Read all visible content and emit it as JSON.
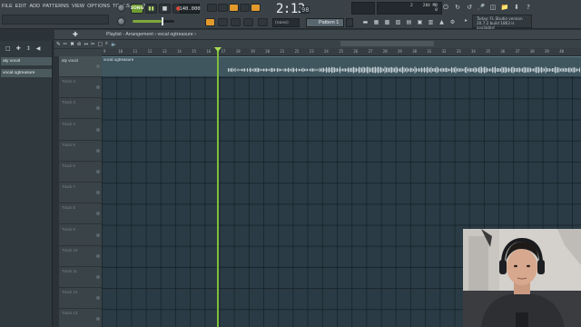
{
  "menu": [
    "FILE",
    "EDIT",
    "ADD",
    "PATTERNS",
    "VIEW",
    "OPTIONS",
    "TOOLS",
    "HELP"
  ],
  "transport": {
    "mode_label": "SONG",
    "play_icon": "play-icon",
    "stop_icon": "stop-icon",
    "record_icon": "record-icon",
    "tempo": "140.000"
  },
  "time": {
    "main": "2:13",
    "sub": "98"
  },
  "pattern": {
    "mode": "(none)",
    "selected": "Pattern 1"
  },
  "cpu": {
    "number": "2",
    "memory": "284 MB",
    "polyphony": "0"
  },
  "news": {
    "line1": "Today: FL Studio version",
    "line2": "20.7.2 build 1863 is available!"
  },
  "browser": {
    "items": [
      {
        "label": "aty vocal"
      },
      {
        "label": "vocal ogtreasure"
      }
    ]
  },
  "playlist": {
    "title": "Playlist - Arrangement › vocal ogtreasure ›",
    "clip_title": "vocal ogtreasure",
    "ruler": [
      "9",
      "10",
      "11",
      "12",
      "13",
      "14",
      "15",
      "16",
      "17",
      "18",
      "19",
      "20",
      "21",
      "22",
      "23",
      "24",
      "25",
      "26",
      "27",
      "28",
      "29",
      "30",
      "31",
      "32",
      "33",
      "34",
      "35",
      "36",
      "37",
      "38",
      "39",
      "40"
    ],
    "tracks": [
      "aty vocal",
      "Track 2",
      "Track 3",
      "Track 4",
      "Track 5",
      "Track 6",
      "Track 7",
      "Track 8",
      "Track 9",
      "Track 10",
      "Track 11",
      "Track 12",
      "Track 13"
    ]
  },
  "colors": {
    "accent_green": "#7fbd3a",
    "accent_orange": "#e39a2c",
    "grid_bg": "#2a3b45",
    "clip_bg": "#3f565f"
  }
}
